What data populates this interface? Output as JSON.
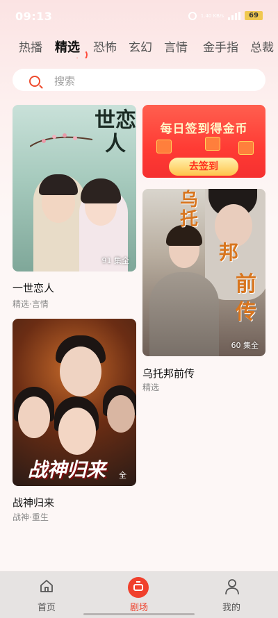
{
  "status_bar": {
    "time": "09:13",
    "net_speed": "1.40 KB/s",
    "battery": "69"
  },
  "tabs": [
    "热播",
    "精选",
    "恐怖",
    "玄幻",
    "言情",
    "金手指",
    "总裁"
  ],
  "active_tab": "精选",
  "search": {
    "placeholder": "搜索"
  },
  "cards": [
    {
      "poster_title": "世恋人",
      "episodes": "91 集全",
      "title": "一世恋人",
      "tags": "精选·言情"
    },
    {
      "poster_title_1": "乌托",
      "poster_title_2": "邦",
      "poster_title_3": "前传",
      "episodes": "60 集全",
      "title": "乌托邦前传",
      "tags": "精选"
    },
    {
      "poster_title": "战神归来",
      "episodes": "全",
      "title": "战神归来",
      "tags": "战神·重生"
    }
  ],
  "promo": {
    "title": "每日签到得金币",
    "button": "去签到"
  },
  "bottom_nav": [
    {
      "label": "首页",
      "icon": "home-icon"
    },
    {
      "label": "剧场",
      "icon": "tv-icon"
    },
    {
      "label": "我的",
      "icon": "user-icon"
    }
  ],
  "colors": {
    "accent": "#ee3f2a",
    "background": "#fdf7f6"
  }
}
